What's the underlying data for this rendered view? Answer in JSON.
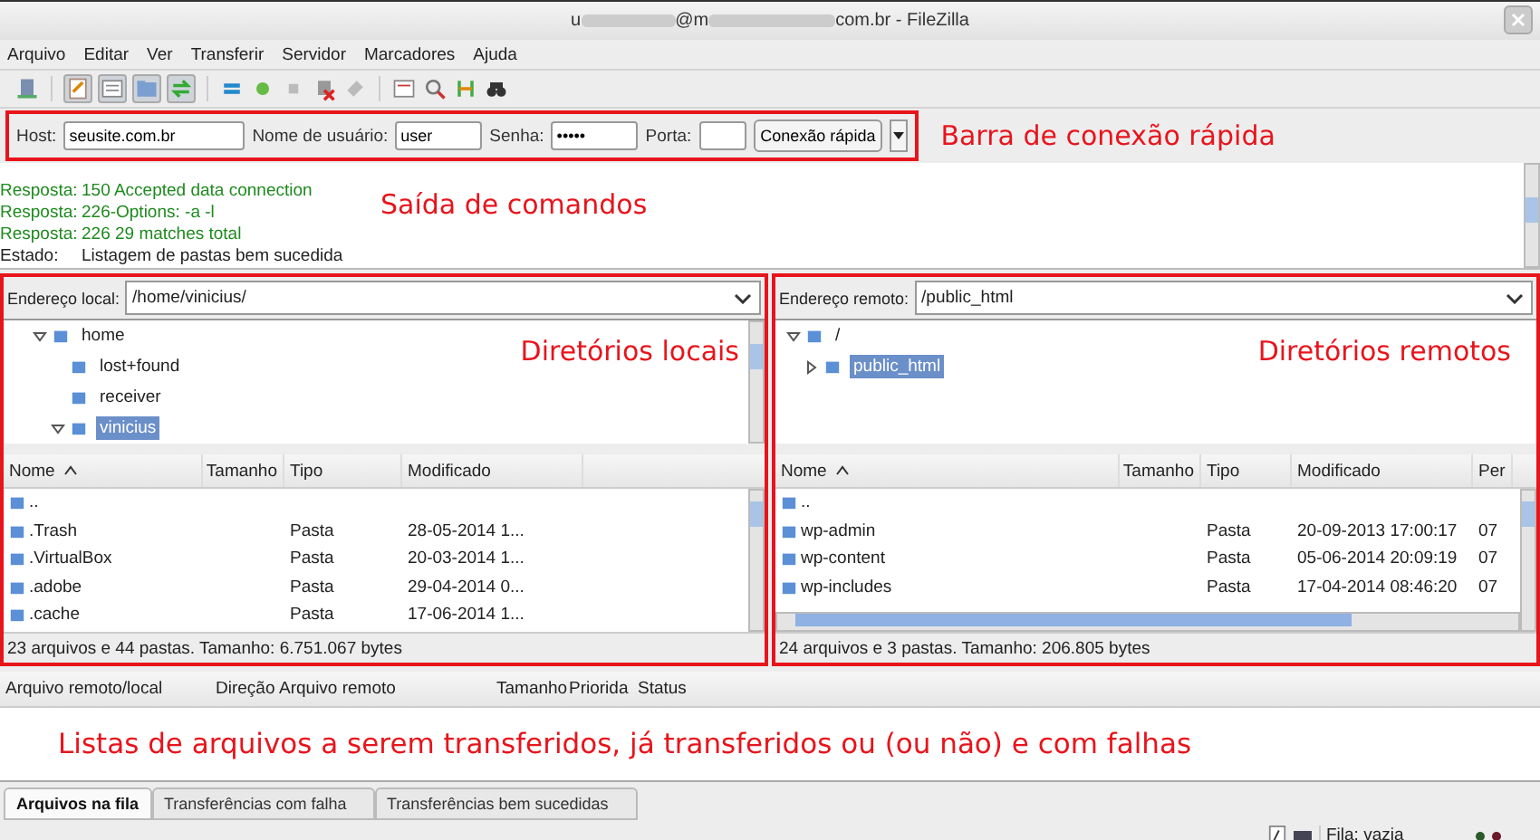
{
  "window": {
    "title_parts": [
      "u",
      "@m",
      "com.br - FileZilla"
    ]
  },
  "menu": [
    "Arquivo",
    "Editar",
    "Ver",
    "Transferir",
    "Servidor",
    "Marcadores",
    "Ajuda"
  ],
  "quickconnect": {
    "host_label": "Host:",
    "host": "seusite.com.br",
    "user_label": "Nome de usuário:",
    "user": "user",
    "password_label": "Senha:",
    "password": "•••••",
    "port_label": "Porta:",
    "connect": "Conexão rápida"
  },
  "annotations": [
    "Barra de conexão rápida",
    "Saída de comandos",
    "Diretórios locais",
    "Diretórios remotos",
    "Listas de arquivos a serem transferidos, já transferidos ou (ou não) e com falhas"
  ],
  "log": [
    {
      "label": "Resposta:",
      "text": "150 Accepted data connection",
      "kind": "response"
    },
    {
      "label": "Resposta:",
      "text": "226-Options: -a -l",
      "kind": "response"
    },
    {
      "label": "Resposta:",
      "text": "226 29 matches total",
      "kind": "response"
    },
    {
      "label": "Estado:",
      "text": "Listagem de pastas bem sucedida",
      "kind": "status"
    }
  ],
  "local": {
    "address_label": "Endereço local:",
    "address": "/home/vinicius/",
    "tree": [
      {
        "name": "home",
        "expanded": true,
        "selected": false,
        "children": [
          {
            "name": "lost+found",
            "selected": false
          },
          {
            "name": "receiver",
            "selected": false
          },
          {
            "name": "vinicius",
            "expanded": true,
            "selected": true
          }
        ]
      }
    ],
    "columns": [
      "Nome",
      "Tamanho",
      "Tipo",
      "Modificado"
    ],
    "rows": [
      [
        "..",
        "",
        "",
        ""
      ],
      [
        ".Trash",
        "",
        "Pasta",
        "28-05-2014 1..."
      ],
      [
        ".VirtualBox",
        "",
        "Pasta",
        "20-03-2014 1..."
      ],
      [
        ".adobe",
        "",
        "Pasta",
        "29-04-2014 0..."
      ],
      [
        ".cache",
        "",
        "Pasta",
        "17-06-2014 1..."
      ]
    ],
    "status": "23 arquivos e 44 pastas. Tamanho: 6.751.067 bytes"
  },
  "remote": {
    "address_label": "Endereço remoto:",
    "address": "/public_html",
    "tree": [
      {
        "name": "/",
        "expanded": true,
        "selected": false,
        "children": [
          {
            "name": "public_html",
            "expanded": false,
            "selected": true
          }
        ]
      }
    ],
    "columns": [
      "Nome",
      "Tamanho",
      "Tipo",
      "Modificado",
      "Per"
    ],
    "rows": [
      [
        "..",
        "",
        "",
        "",
        ""
      ],
      [
        "wp-admin",
        "",
        "Pasta",
        "20-09-2013 17:00:17",
        "07"
      ],
      [
        "wp-content",
        "",
        "Pasta",
        "05-06-2014 20:09:19",
        "07"
      ],
      [
        "wp-includes",
        "",
        "Pasta",
        "17-04-2014 08:46:20",
        "07"
      ]
    ],
    "status": "24 arquivos e 3 pastas. Tamanho: 206.805 bytes"
  },
  "queue": {
    "columns": [
      "Arquivo remoto/local",
      "Direção",
      "Arquivo remoto",
      "Tamanho",
      "Priorida",
      "Status"
    ]
  },
  "tabs": [
    {
      "label": "Arquivos na fila",
      "selected": true
    },
    {
      "label": "Transferências com falha",
      "selected": false
    },
    {
      "label": "Transferências bem sucedidas",
      "selected": false
    }
  ],
  "status_bar": {
    "queue": "Fila: vazia"
  }
}
